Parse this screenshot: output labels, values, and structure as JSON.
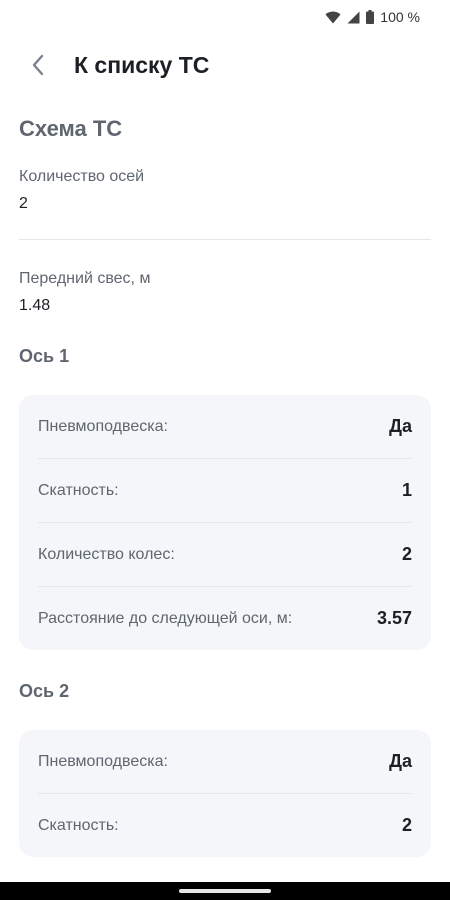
{
  "status_bar": {
    "battery": "100 %"
  },
  "header": {
    "title": "К списку ТС"
  },
  "scheme": {
    "title": "Схема ТС",
    "axles_label": "Количество осей",
    "axles_value": "2",
    "overhang_label": "Передний свес, м",
    "overhang_value": "1.48"
  },
  "axes": [
    {
      "title": "Ось 1",
      "rows": [
        {
          "label": "Пневмоподвеска:",
          "value": "Да"
        },
        {
          "label": "Скатность:",
          "value": "1"
        },
        {
          "label": "Количество колес:",
          "value": "2"
        },
        {
          "label": "Расстояние до следующей оси, м:",
          "value": "3.57"
        }
      ]
    },
    {
      "title": "Ось 2",
      "rows": [
        {
          "label": "Пневмоподвеска:",
          "value": "Да"
        },
        {
          "label": "Скатность:",
          "value": "2"
        }
      ]
    }
  ]
}
